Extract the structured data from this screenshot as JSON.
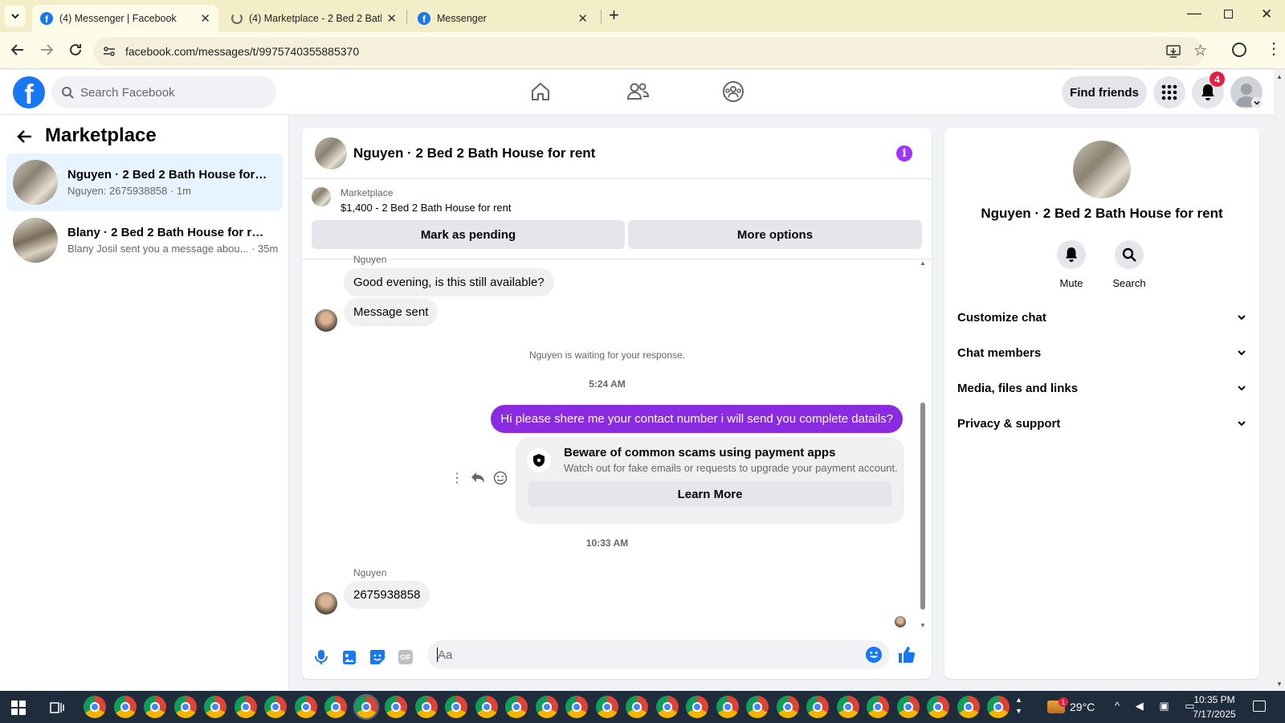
{
  "browser": {
    "tabs": [
      {
        "title": "(4) Messenger | Facebook",
        "active": true
      },
      {
        "title": "(4) Marketplace - 2 Bed 2 Bath H",
        "active": false
      },
      {
        "title": "Messenger",
        "active": false
      }
    ],
    "url": "facebook.com/messages/t/9975740355885370"
  },
  "header": {
    "search_placeholder": "Search Facebook",
    "find_friends_label": "Find friends",
    "notification_count": "4"
  },
  "sidebar": {
    "title": "Marketplace",
    "conversations": [
      {
        "name": "Nguyen · 2 Bed 2 Bath House for r...",
        "preview": "Nguyen: 2675938858 · 1m",
        "selected": true
      },
      {
        "name": "Blany · 2 Bed 2 Bath House for rent",
        "preview": "Blany Josil sent you a message abou... · 35m",
        "selected": false
      }
    ]
  },
  "chat": {
    "title": "Nguyen · 2 Bed 2 Bath House for rent",
    "listing_source": "Marketplace",
    "listing_title": "$1,400 - 2 Bed 2 Bath House for rent",
    "mark_pending_label": "Mark as pending",
    "more_options_label": "More options",
    "messages": {
      "sender_name_top": "Nguyen",
      "msg1": "Good evening, is this still available?",
      "msg2": "Message sent",
      "waiting_notice": "Nguyen is waiting for your response.",
      "time1": "5:24 AM",
      "outgoing": "Hi please shere me your contact number i will send you complete datails?",
      "scam_title": "Beware of common scams using payment apps",
      "scam_body": "Watch out for fake emails or requests to upgrade your payment account.",
      "learn_more_label": "Learn More",
      "time2": "10:33 AM",
      "sender_name_bottom": "Nguyen",
      "msg3": "2675938858"
    },
    "composer_placeholder": "Aa"
  },
  "details": {
    "title": "Nguyen · 2 Bed 2 Bath House for rent",
    "mute_label": "Mute",
    "search_label": "Search",
    "sections": [
      "Customize chat",
      "Chat members",
      "Media, files and links",
      "Privacy & support"
    ]
  },
  "taskbar": {
    "weather": "29°C",
    "time": "10:35 PM",
    "date": "7/17/2025",
    "notification_badge": "1"
  },
  "colors": {
    "brand": "#1877f2",
    "accent": "#a033ff",
    "outgoing_bubble": "#8a2be2"
  }
}
